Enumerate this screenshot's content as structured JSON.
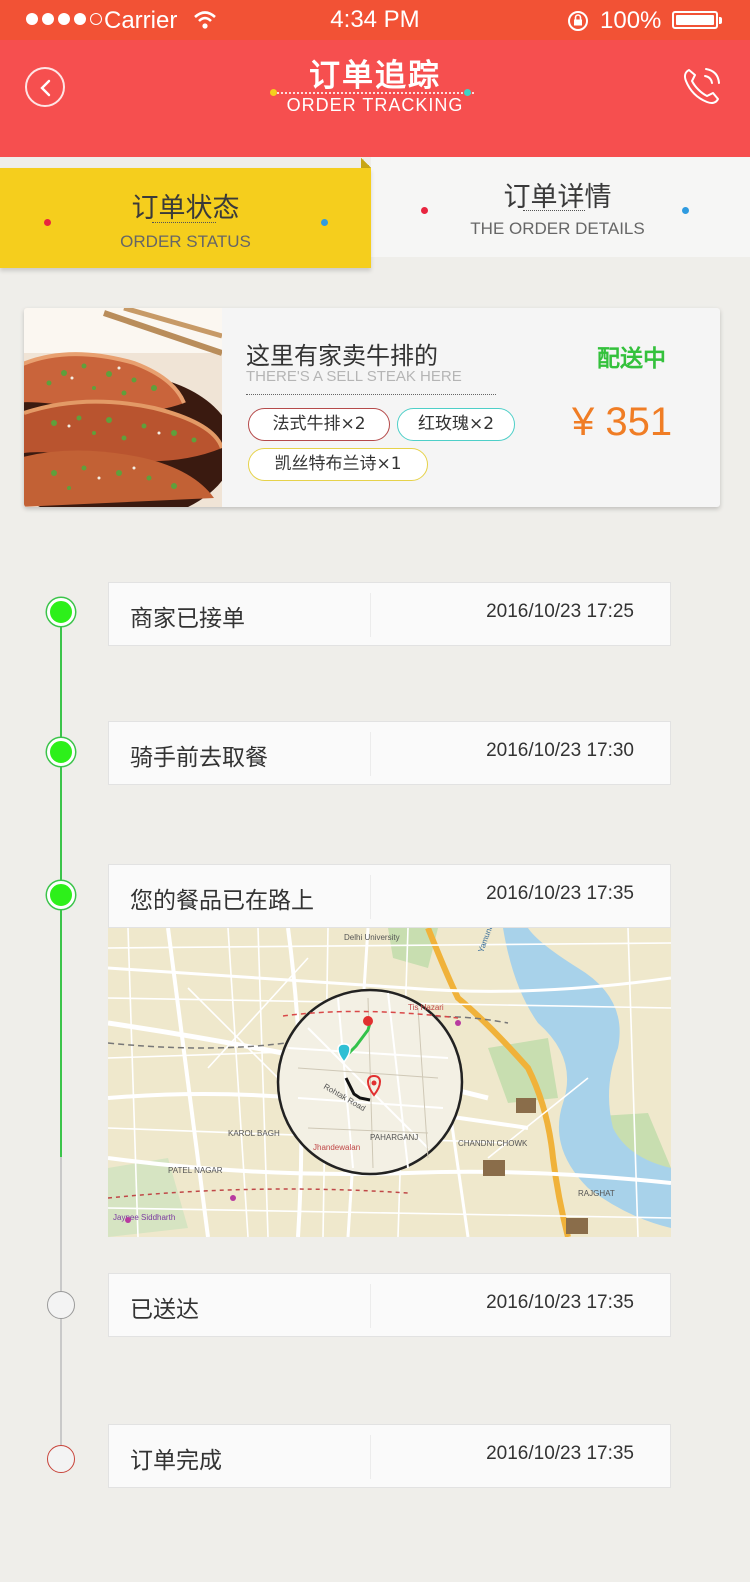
{
  "status_bar": {
    "carrier": "Carrier",
    "time": "4:34 PM",
    "battery": "100%"
  },
  "header": {
    "title_cn": "订单追踪",
    "title_en": "ORDER TRACKING"
  },
  "tabs": {
    "status": {
      "cn": "订单状态",
      "en": "ORDER STATUS",
      "active": true
    },
    "details": {
      "cn": "订单详情",
      "en": "THE ORDER DETAILS",
      "active": false
    }
  },
  "order": {
    "shop_name": "这里有家卖牛排的",
    "shop_name_en": "THERE'S A SELL STEAK HERE",
    "status": "配送中",
    "price": "¥ 351",
    "items": [
      {
        "label": "法式牛排×2",
        "color": "#b54a4a"
      },
      {
        "label": "红玫瑰×2",
        "color": "#4ecfc8"
      },
      {
        "label": "凯丝特布兰诗×1",
        "color": "#e6d24a"
      }
    ]
  },
  "timeline": [
    {
      "label": "商家已接单",
      "time": "2016/10/23 17:25",
      "state": "done"
    },
    {
      "label": "骑手前去取餐",
      "time": "2016/10/23 17:30",
      "state": "done"
    },
    {
      "label": "您的餐品已在路上",
      "time": "2016/10/23 17:35",
      "state": "done"
    },
    {
      "label": "已送达",
      "time": "2016/10/23 17:35",
      "state": "pending"
    },
    {
      "label": "订单完成",
      "time": "2016/10/23 17:35",
      "state": "final"
    }
  ],
  "map": {
    "labels": {
      "delhi_university": "Delhi University",
      "yamuna_river": "Yamuna River",
      "karol_bagh": "KAROL BAGH",
      "patel_nagar": "PATEL NAGAR",
      "paharganj": "PAHARGANJ",
      "chandni_chowk": "CHANDNI CHOWK",
      "rajghat": "RAJGHAT",
      "rohtak_road": "Rohtak Road",
      "tis_hazari": "Tis Hazari",
      "jhandewalan": "Jhandewalan",
      "jaypee": "Jaypee Siddharth"
    }
  },
  "colors": {
    "header": "#f64f4f",
    "status_bar": "#f25235",
    "tab_active": "#f5ce1d",
    "delivering": "#34c13c",
    "price": "#f07d25",
    "timeline_done": "#2df01a"
  }
}
